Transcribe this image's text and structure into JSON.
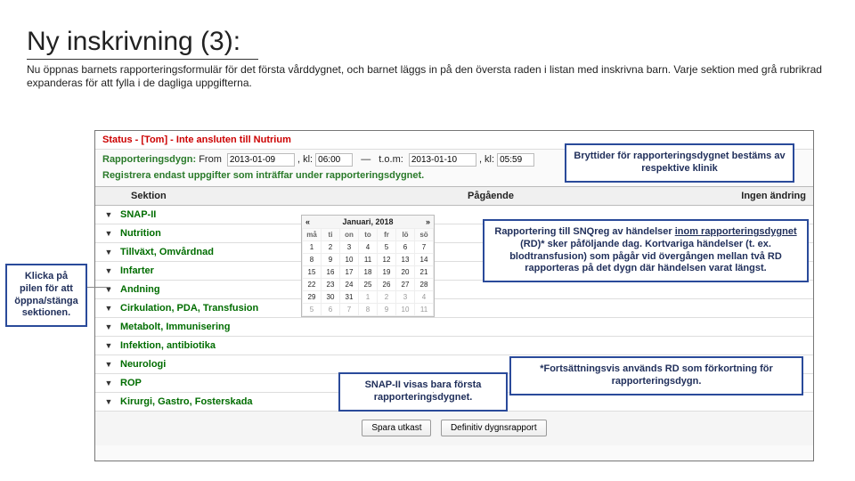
{
  "title": "Ny inskrivning (3):",
  "intro": "Nu öppnas barnets rapporteringsformulär för det första vårddygnet, och barnet läggs in på den översta raden i listan med inskrivna barn. Varje sektion med grå rubrikrad expanderas för att fylla i de dagliga uppgifterna.",
  "status": "Status - [Tom] - Inte ansluten till Nutrium",
  "rapp_label": "Rapporteringsdygn:",
  "from": "From",
  "to": "t.o.m:",
  "kl": ", kl:",
  "d1": "2013-01-09",
  "t1": "06:00",
  "d2": "2013-01-10",
  "t2": "05:59",
  "endast": "Registrera endast uppgifter som inträffar under rapporteringsdygnet.",
  "hdr1": "Sektion",
  "hdr2": "Pågående",
  "hdr3": "Ingen ändring",
  "sections": [
    "SNAP-II",
    "Nutrition",
    "Tillväxt, Omvårdnad",
    "Infarter",
    "Andning",
    "Cirkulation, PDA, Transfusion",
    "Metabolt, Immunisering",
    "Infektion, antibiotika",
    "Neurologi",
    "ROP",
    "Kirurgi, Gastro, Fosterskada"
  ],
  "cal_title": "Januari, 2018",
  "dow": [
    "må",
    "ti",
    "on",
    "to",
    "fr",
    "lö",
    "sö"
  ],
  "calrows": [
    [
      "1",
      "2",
      "3",
      "4",
      "5",
      "6",
      "7"
    ],
    [
      "8",
      "9",
      "10",
      "11",
      "12",
      "13",
      "14"
    ],
    [
      "15",
      "16",
      "17",
      "18",
      "19",
      "20",
      "21"
    ],
    [
      "22",
      "23",
      "24",
      "25",
      "26",
      "27",
      "28"
    ],
    [
      "29",
      "30",
      "31",
      "1",
      "2",
      "3",
      "4"
    ],
    [
      "5",
      "6",
      "7",
      "8",
      "9",
      "10",
      "11"
    ]
  ],
  "btn_save": "Spara utkast",
  "btn_final": "Definitiv dygnsrapport",
  "c_left": "Klicka på pilen för att öppna/stänga sektionen.",
  "c_top": "Bryttider för rapporteringsdygnet bestäms av respektive klinik",
  "c_right_1": "Rapportering till SNQreg av händelser ",
  "c_right_ul": "inom rapporteringsdygnet",
  "c_right_2": " (RD)* sker påföljande dag. Kortvariga händelser (t. ex. blodtransfusion) som pågår vid övergången mellan två RD rapporteras på det dygn där händelsen varat längst.",
  "c_snap": "SNAP-II visas bara första rapporteringsdygnet.",
  "c_foot": "*Fortsättningsvis används RD som förkortning för rapporteringsdygn."
}
